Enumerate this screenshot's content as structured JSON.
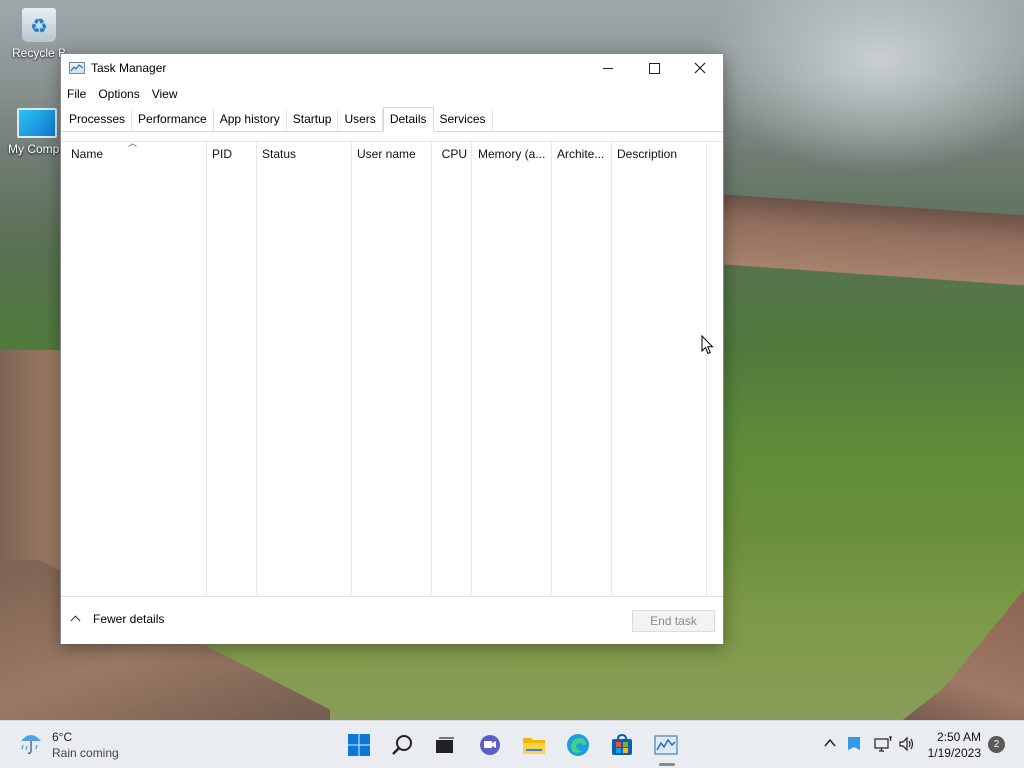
{
  "desktop": {
    "icons": [
      {
        "label": "Recycle Bin",
        "visible_label": "Recycle B"
      },
      {
        "label": "My Computer",
        "visible_label": "My Compu"
      }
    ]
  },
  "window": {
    "title": "Task Manager",
    "menu": [
      "File",
      "Options",
      "View"
    ],
    "tabs": [
      "Processes",
      "Performance",
      "App history",
      "Startup",
      "Users",
      "Details",
      "Services"
    ],
    "active_tab": "Details",
    "columns": [
      "Name",
      "PID",
      "Status",
      "User name",
      "CPU",
      "Memory (a...",
      "Archite...",
      "Description"
    ],
    "rows": [],
    "footer": {
      "fewer_details": "Fewer details",
      "end_task": "End task"
    }
  },
  "taskbar": {
    "weather": {
      "temp": "6°C",
      "desc": "Rain coming"
    },
    "apps": [
      "start-icon",
      "search-icon",
      "task-view-icon",
      "chat-icon",
      "file-explorer-icon",
      "edge-icon",
      "store-icon",
      "task-manager-icon"
    ],
    "clock": {
      "time": "2:50 AM",
      "date": "1/19/2023"
    },
    "notifications": "2"
  },
  "colors": {
    "taskbar_bg": "#e9edf2",
    "window_bg": "#ffffff",
    "accent_blue": "#0078d4",
    "disabled_text": "#8a8a8a"
  }
}
